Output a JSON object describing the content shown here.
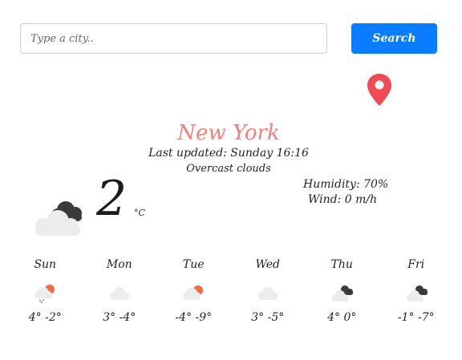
{
  "search": {
    "placeholder": "Type a city..",
    "button_label": "Search"
  },
  "location": {
    "icon": "map-pin-icon",
    "color": "#f04a55"
  },
  "current": {
    "city": "New York",
    "last_updated": "Last updated: Sunday 16:16",
    "conditions": "Overcast clouds",
    "icon": "overcast-clouds-icon",
    "temperature": "2",
    "unit": "°C",
    "humidity": "Humidity: 70%",
    "wind": "Wind: 0 m/h"
  },
  "forecast": [
    {
      "day": "Sun",
      "icon": "sun-snow-cloud-icon",
      "temps": "4° -2°"
    },
    {
      "day": "Mon",
      "icon": "cloud-icon",
      "temps": "3° -4°"
    },
    {
      "day": "Tue",
      "icon": "sun-cloud-icon",
      "temps": "-4° -9°"
    },
    {
      "day": "Wed",
      "icon": "cloud-icon",
      "temps": "3° -5°"
    },
    {
      "day": "Thu",
      "icon": "overcast-clouds-icon",
      "temps": "4° 0°"
    },
    {
      "day": "Fri",
      "icon": "overcast-clouds-icon",
      "temps": "-1° -7°"
    }
  ],
  "colors": {
    "accent": "#0a7cff",
    "city": "#f07f7b",
    "sun": "#f06a46",
    "light_cloud": "#ececec",
    "dark_cloud": "#3a3a3a"
  }
}
